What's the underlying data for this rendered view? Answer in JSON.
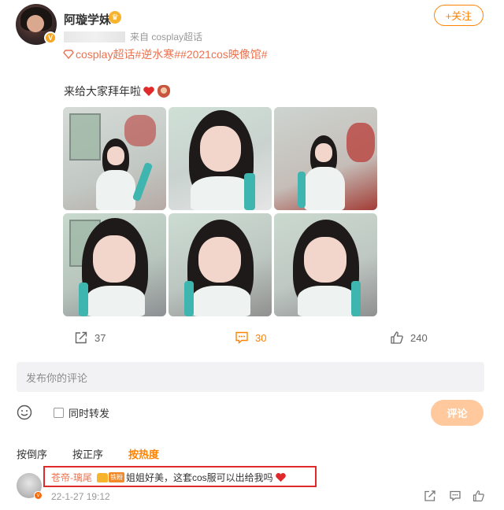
{
  "post": {
    "author": "阿璇学妹",
    "follow_label": "+关注",
    "source": "来自 cosplay超话",
    "topics": "cosplay超话#逆水寒##2021cos映像馆#",
    "text": "来给大家拜年啦",
    "photo_count": 6
  },
  "actions": {
    "share_count": "37",
    "comment_count": "30",
    "like_count": "240"
  },
  "comment_form": {
    "placeholder": "发布你的评论",
    "repost_label": "同时转发",
    "submit_label": "评论"
  },
  "sort": {
    "reverse": "按倒序",
    "forward": "按正序",
    "hot": "按热度"
  },
  "comment": {
    "user": "苍帝-璃尾",
    "badge_tag": "铁粉",
    "text": "姐姐好美，这套cos服可以出给我吗",
    "time": "22-1-27 19:12"
  },
  "colors": {
    "accent": "#ff8200",
    "topic": "#eb7350",
    "highlight_box": "#e0292b"
  }
}
